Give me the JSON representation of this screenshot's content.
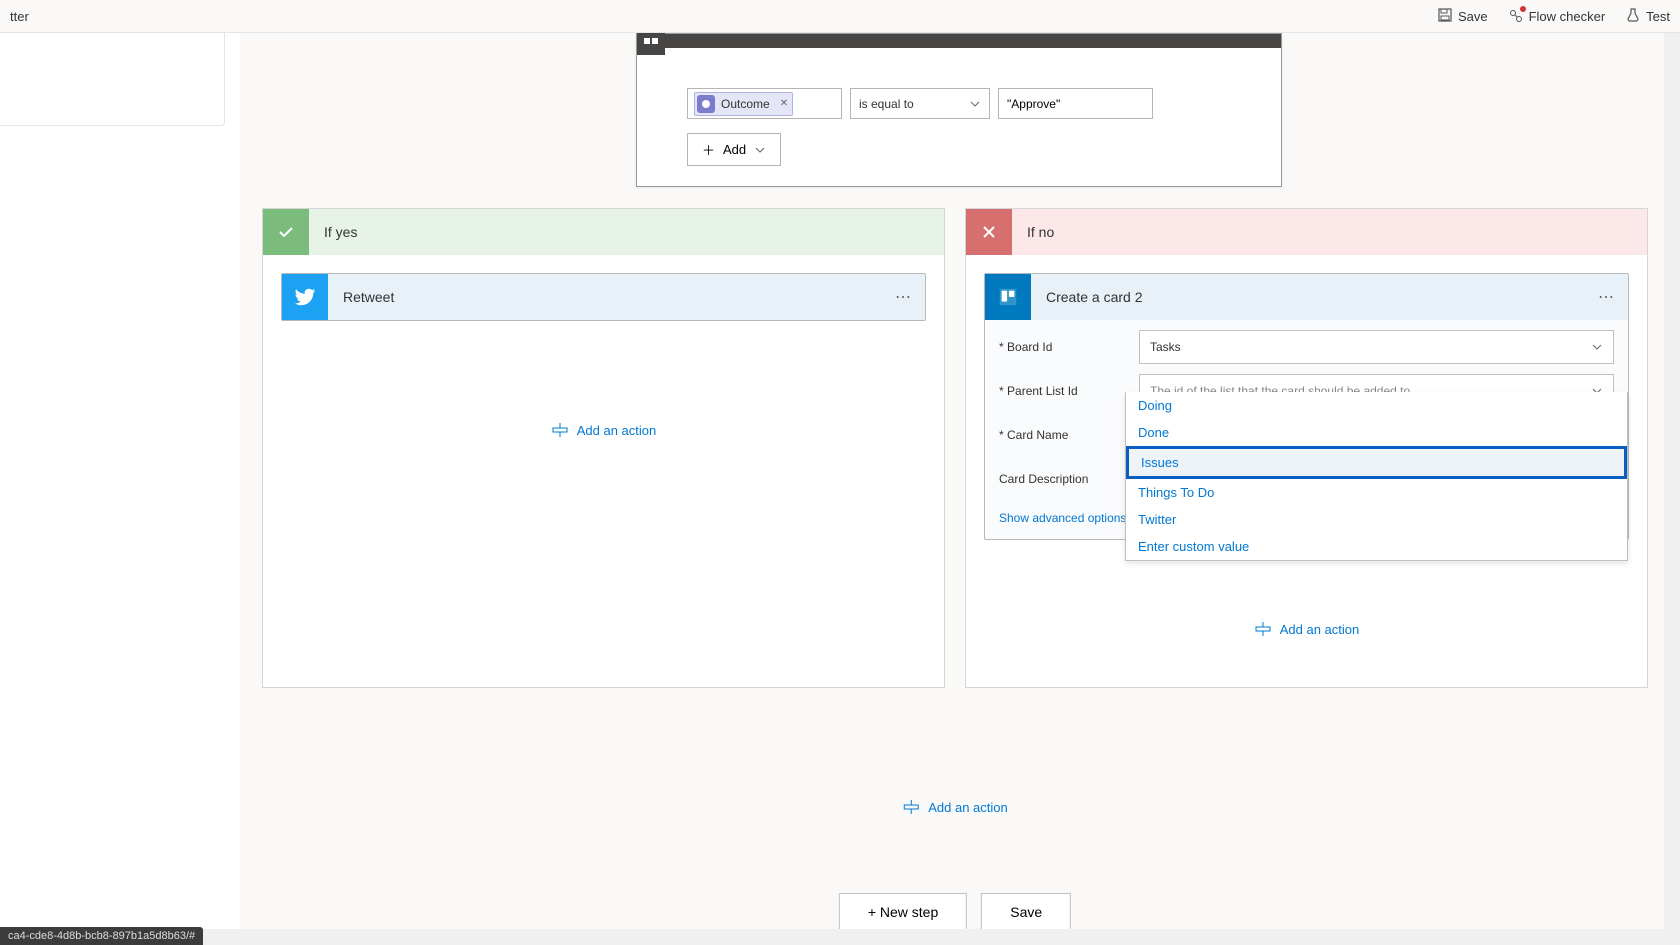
{
  "topbar": {
    "title_fragment": "tter",
    "save": "Save",
    "flow_checker": "Flow checker",
    "test": "Test"
  },
  "condition": {
    "token_label": "Outcome",
    "operator": "is equal to",
    "value": "\"Approve\"",
    "add_label": "Add"
  },
  "branch_yes": {
    "label": "If yes",
    "action_title": "Retweet",
    "add_action": "Add an action"
  },
  "branch_no": {
    "label": "If no",
    "action_title": "Create a card 2",
    "fields": {
      "board_label": "Board Id",
      "board_value": "Tasks",
      "parent_label": "Parent List Id",
      "parent_placeholder": "The id of the list that the card should be added to.",
      "card_name_label": "Card Name",
      "card_desc_label": "Card Description"
    },
    "show_advanced": "Show advanced options",
    "dropdown": {
      "items": [
        "Doing",
        "Done",
        "Issues",
        "Things To Do",
        "Twitter"
      ],
      "custom": "Enter custom value",
      "highlighted_index": 2
    },
    "add_action": "Add an action"
  },
  "global_add_action": "Add an action",
  "footer": {
    "new_step": "+ New step",
    "save": "Save"
  },
  "status_text": "ca4-cde8-4d8b-bcb8-897b1a5d8b63/#"
}
